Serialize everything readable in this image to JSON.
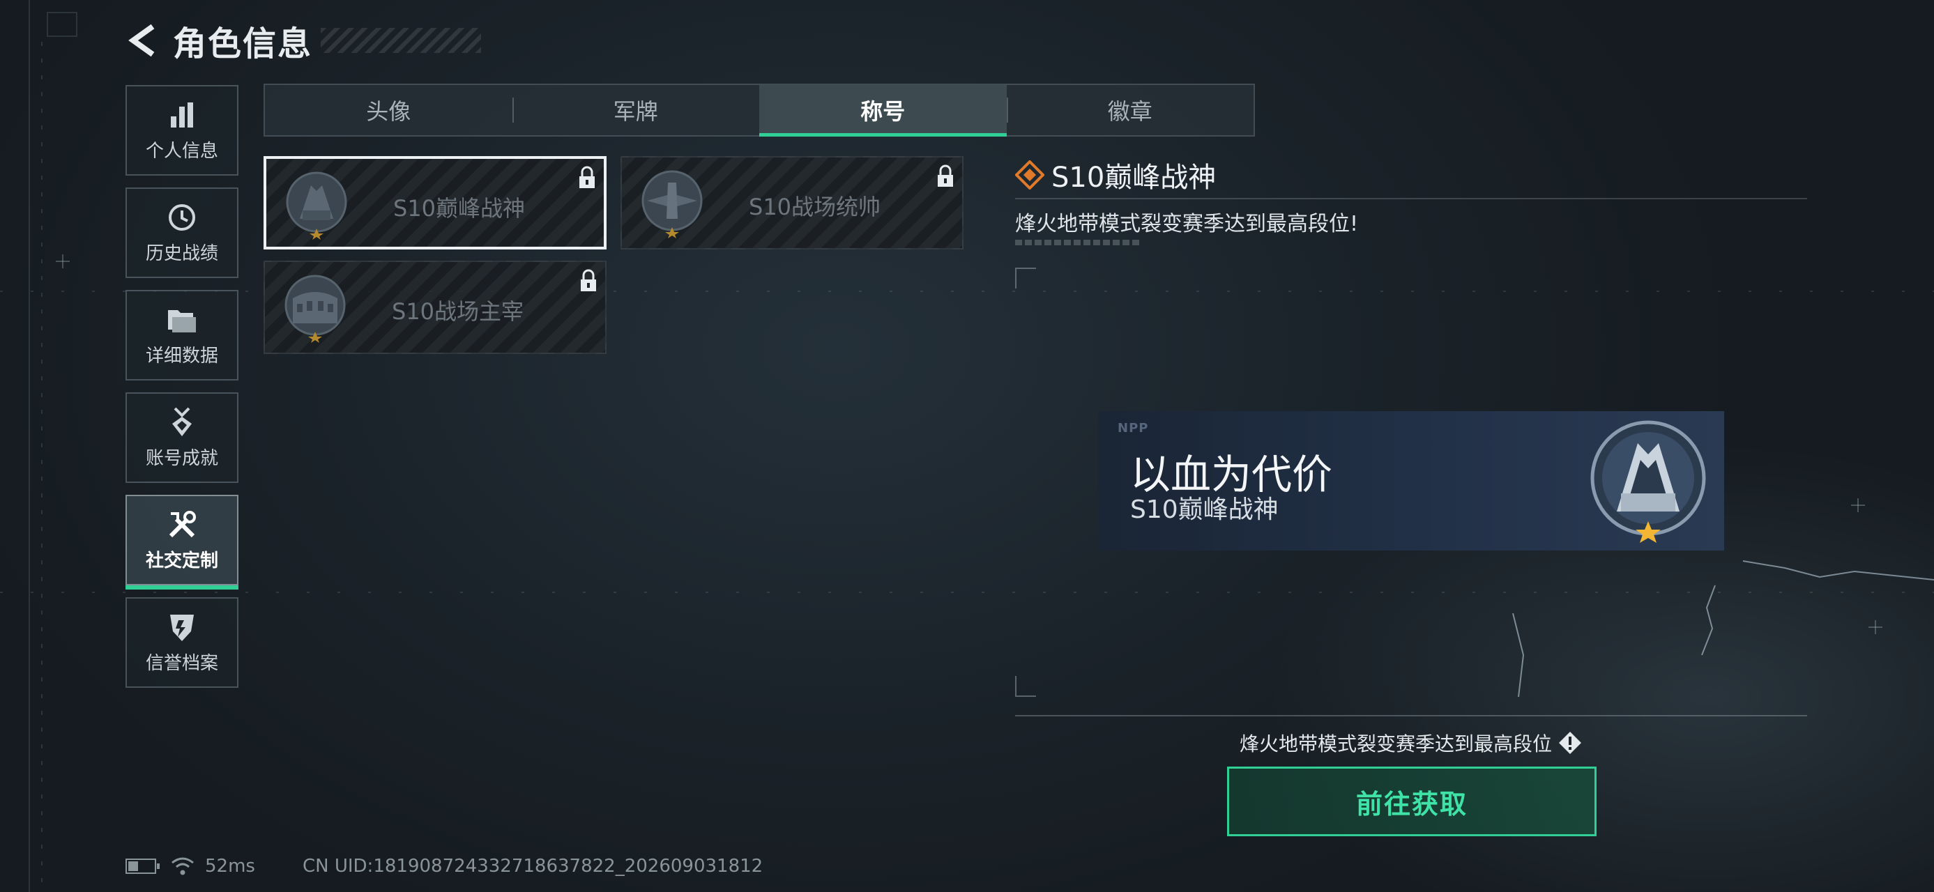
{
  "header": {
    "title": "角色信息"
  },
  "sidebar": {
    "items": [
      {
        "label": "个人信息",
        "icon": "bar-chart-icon",
        "active": false
      },
      {
        "label": "历史战绩",
        "icon": "history-clock-icon",
        "active": false
      },
      {
        "label": "详细数据",
        "icon": "folder-icon",
        "active": false
      },
      {
        "label": "账号成就",
        "icon": "medal-icon",
        "active": false
      },
      {
        "label": "社交定制",
        "icon": "tools-icon",
        "active": true
      },
      {
        "label": "信誉档案",
        "icon": "shield-icon",
        "active": false
      }
    ]
  },
  "tabs": [
    {
      "label": "头像",
      "active": false
    },
    {
      "label": "军牌",
      "active": false
    },
    {
      "label": "称号",
      "active": true
    },
    {
      "label": "徽章",
      "active": false
    }
  ],
  "titles": [
    {
      "name": "S10巅峰战神",
      "locked": true,
      "selected": true,
      "emblem": "tower-emblem-icon"
    },
    {
      "name": "S10战场统帅",
      "locked": true,
      "selected": false,
      "emblem": "aircraft-emblem-icon"
    },
    {
      "name": "S10战场主宰",
      "locked": true,
      "selected": false,
      "emblem": "colosseum-emblem-icon"
    }
  ],
  "detail": {
    "name": "S10巅峰战神",
    "description": "烽火地带模式裂变赛季达到最高段位!",
    "banner": {
      "mark": "NPP",
      "title": "以血为代价",
      "subtitle": "S10巅峰战神"
    },
    "requirement": "烽火地带模式裂变赛季达到最高段位",
    "action_label": "前往获取"
  },
  "status": {
    "ping": "52ms",
    "uid": "CN UID:181908724332718637822_202609031812",
    "battery_level": 0.4
  },
  "colors": {
    "accent": "#2fcf95",
    "rarity": "#e07a2a"
  }
}
